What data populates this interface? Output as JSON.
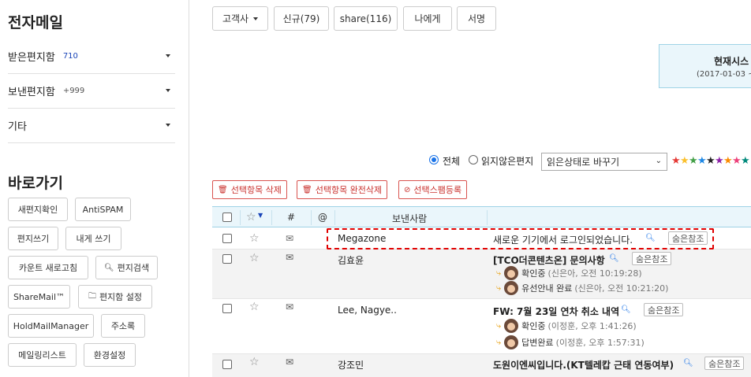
{
  "sidebar": {
    "title": "전자메일",
    "folders": [
      {
        "label": "받은편지함",
        "count": "710",
        "count_color": "#1a45b8"
      },
      {
        "label": "보낸편지함",
        "count": "+999",
        "count_color": "#555555"
      },
      {
        "label": "기타",
        "count": ""
      }
    ],
    "shortcuts_title": "바로가기",
    "shortcuts": [
      {
        "label": "새편지확인"
      },
      {
        "label": "AntiSPAM"
      },
      {
        "label": "편지쓰기"
      },
      {
        "label": "내게 쓰기"
      },
      {
        "label": "카운트 새로고침"
      },
      {
        "label": "편지검색",
        "icon": "search-icon"
      },
      {
        "label": "ShareMail™"
      },
      {
        "label": "편지함 설정",
        "icon": "folder-icon"
      },
      {
        "label": "HoldMailManager"
      },
      {
        "label": "주소록"
      },
      {
        "label": "메일링리스트"
      },
      {
        "label": "환경설정"
      }
    ]
  },
  "toolbar": {
    "buttons": [
      {
        "label": "고객사",
        "dropdown": true
      },
      {
        "label": "신규(79)"
      },
      {
        "label": "share(116)"
      },
      {
        "label": "나에게"
      },
      {
        "label": "서명"
      }
    ]
  },
  "status": {
    "title": "현재시스",
    "date": "(2017-01-03 ~"
  },
  "filter": {
    "options": [
      "전체",
      "읽지않은편지"
    ],
    "selected": "전체",
    "read_select": "읽은상태로 바꾸기",
    "star_colors": [
      "#e53935",
      "#fbc02d",
      "#43a047",
      "#1e88e5",
      "#222222",
      "#8e24aa",
      "#fb8c00",
      "#ec407a",
      "#00897b"
    ]
  },
  "actions": [
    {
      "label": "선택항목 삭제",
      "icon": "trash-icon"
    },
    {
      "label": "선택항목 완전삭제",
      "icon": "trash-icon"
    },
    {
      "label": "선택스팸등록",
      "icon": "ban-icon"
    }
  ],
  "list_header": {
    "num": "#",
    "at": "@",
    "sender": "보낸사람"
  },
  "messages": [
    {
      "sender": "Megazone",
      "subject": "새로운 기기에서 로그인되었습니다.",
      "hidden_ref": "숨은참조",
      "read": true,
      "replies": []
    },
    {
      "sender": "김효윤",
      "subject": "[TCO더콘텐츠온] 문의사항",
      "hidden_ref": "숨은참조",
      "read": false,
      "replies": [
        {
          "label": "확인중",
          "meta": "(신은아, 오전 10:19:28)"
        },
        {
          "label": "유선안내 완료",
          "meta": "(신은아, 오전 10:21:20)"
        }
      ]
    },
    {
      "sender": "Lee, Nagye..",
      "subject": "FW: 7월 23일 연차 취소 내역",
      "hidden_ref": "숨은참조",
      "read": false,
      "replies": [
        {
          "label": "확인중",
          "meta": "(이정훈, 오후 1:41:26)"
        },
        {
          "label": "답변완료",
          "meta": "(이정훈, 오후 1:57:31)"
        }
      ]
    },
    {
      "sender": "강조민",
      "subject": "도원이엔씨입니다.(KT텔레캅 근태 연동여부)",
      "hidden_ref": "숨은참조",
      "read": false,
      "replies": []
    }
  ]
}
